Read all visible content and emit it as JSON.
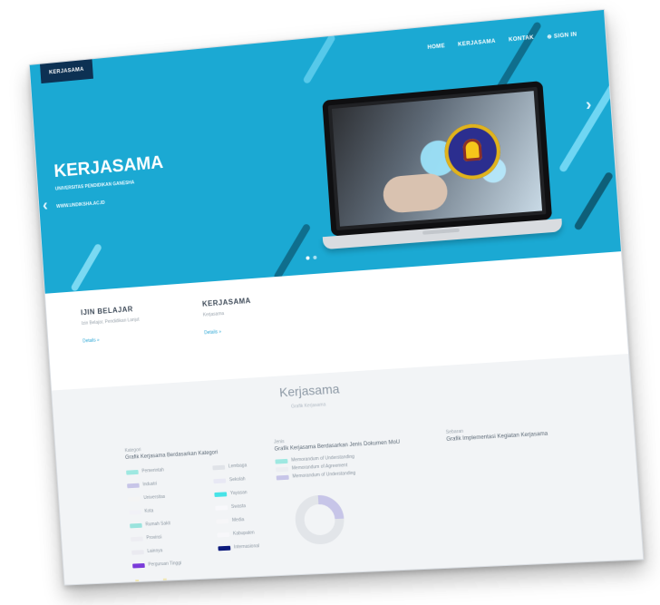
{
  "header": {
    "badge": "KERJASAMA",
    "nav": [
      "HOME",
      "KERJASAMA",
      "KONTAK",
      "⊕ SIGN IN"
    ]
  },
  "hero": {
    "title": "KERJASAMA",
    "subtitle": "UNIVERSITAS PENDIDIKAN GANESHA",
    "url": "WWW.UNDIKSHA.AC.ID",
    "left_arrow": "‹",
    "right_arrow": "›"
  },
  "features": [
    {
      "title": "IJIN BELAJAR",
      "desc": "Izin Belajar, Pendidikan Lanjut",
      "link": "Details »"
    },
    {
      "title": "KERJASAMA",
      "desc": "Kerjasama",
      "link": "Details »"
    }
  ],
  "kerjasama": {
    "title": "Kerjasama",
    "subtitle": "Grafik Kerjasama"
  },
  "columns": [
    {
      "label": "Kategori",
      "title": "Grafik Kerjasama Berdasarkan Kategori",
      "legend": [
        {
          "text": "Pemerintah",
          "color": "#9ee8e1"
        },
        {
          "text": "Lembaga",
          "color": "#e0e3e8"
        },
        {
          "text": "Industri",
          "color": "#c7c5e8"
        },
        {
          "text": "Sekolah",
          "color": "#e8e8f4"
        },
        {
          "text": "Universitas",
          "color": "#f4f4f4"
        },
        {
          "text": "Yayasan",
          "color": "#47e3e7"
        },
        {
          "text": "Kota",
          "color": "#f1f1f7"
        },
        {
          "text": "Swasta",
          "color": "#f8f8fb"
        },
        {
          "text": "Rumah Sakit",
          "color": "#9ae3dd"
        },
        {
          "text": "Media",
          "color": "#f6f6f8"
        },
        {
          "text": "Provinsi",
          "color": "#ededf2"
        },
        {
          "text": "Kabupaten",
          "color": "#f7f7fa"
        },
        {
          "text": "Lainnya",
          "color": "#eaeaf0"
        },
        {
          "text": "Internasional",
          "color": "#0c1a7c"
        },
        {
          "text": "Perguruan Tinggi",
          "color": "#7a3bd9"
        }
      ]
    },
    {
      "label": "Jenis",
      "title": "Grafik Kerjasama Berdasarkan Jenis Dokumen MoU",
      "legend": [
        {
          "text": "Memorandum of Understanding",
          "color": "#9ee8e1"
        },
        {
          "text": "Memorandum of Agreement",
          "color": "#eceef2"
        },
        {
          "text": "Memorandum of Understanding",
          "color": "#c7c5e8"
        }
      ]
    },
    {
      "label": "Sebaran",
      "title": "Grafik Implementasi Kegiatan Kerjasama",
      "legend": []
    }
  ],
  "icons": [
    "laptop-image",
    "ganesha-logo-icon",
    "arrow-left-icon",
    "arrow-right-icon"
  ],
  "colors": {
    "hero_bg": "#1ba9d3",
    "badge_bg": "#0d3153",
    "accent": "#27a5d4"
  }
}
